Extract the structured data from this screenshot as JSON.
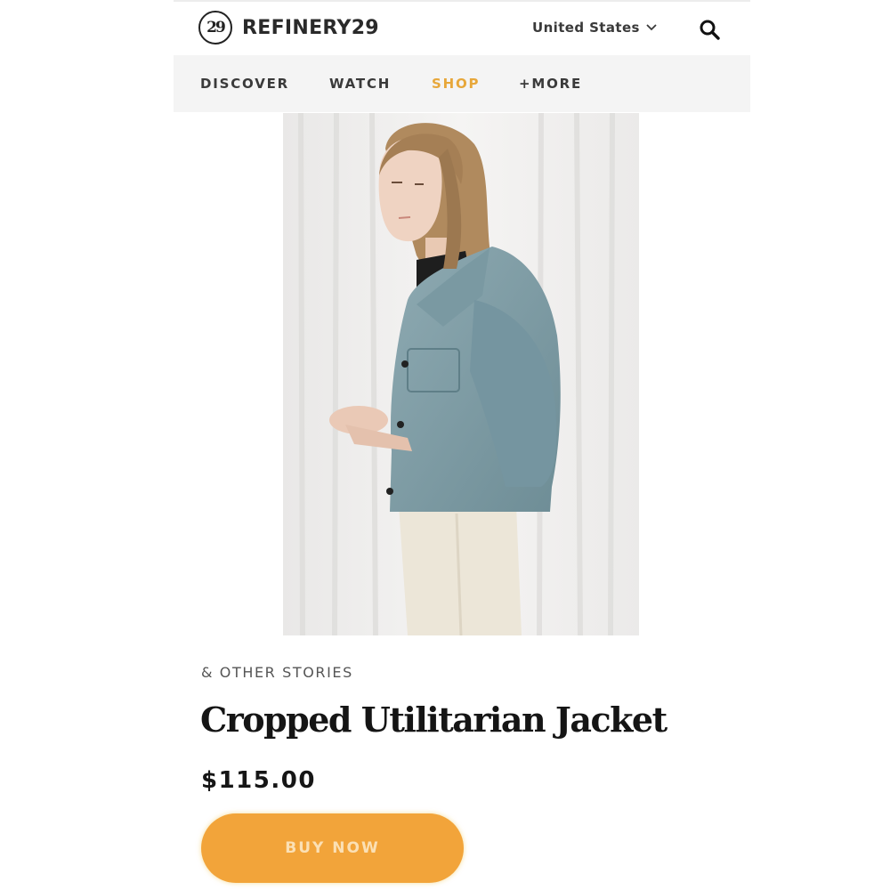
{
  "header": {
    "logo_mark": "29",
    "logo_text": "REFINERY29",
    "region": "United States",
    "icons": {
      "region_dropdown": "chevron-down-icon",
      "search": "search-icon"
    }
  },
  "nav": {
    "items": [
      {
        "label": "DISCOVER",
        "active": false
      },
      {
        "label": "WATCH",
        "active": false
      },
      {
        "label": "SHOP",
        "active": true
      },
      {
        "label": "+MORE",
        "active": false
      }
    ]
  },
  "product": {
    "image": "photo of model wearing a cropped blue utilitarian jacket and cream trousers",
    "brand": "& OTHER STORIES",
    "title": "Cropped Utilitarian Jacket",
    "price": "$115.00",
    "buy_label": "BUY NOW"
  },
  "colors": {
    "accent": "#e7a73a",
    "button": "#f2a43a",
    "button_text": "#fbe0b5",
    "nav_bg": "#f4f4f4",
    "jacket": "#7f9fa8"
  }
}
